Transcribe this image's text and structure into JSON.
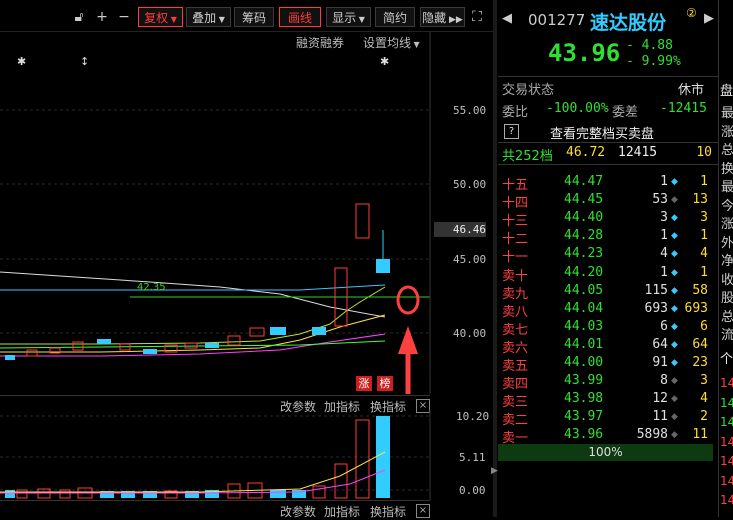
{
  "toolbar": {
    "fq_label": "复权",
    "overlay_label": "叠加",
    "chips_label": "筹码",
    "draw_label": "画线",
    "display_label": "显示",
    "simple_label": "简约",
    "hide_label": "隐藏"
  },
  "chart_header": {
    "margin_label": "融资融券",
    "ma_label": "设置均线"
  },
  "main_chart": {
    "y_ticks": [
      "55.00",
      "50.00",
      "45.00",
      "40.00"
    ],
    "current_price_tag": "46.46",
    "level_label": "42.35",
    "badge_up": "涨",
    "badge_list": "榜"
  },
  "sub_panel_top": {
    "edit_params": "改参数",
    "add_indicator": "加指标",
    "switch_indicator": "换指标"
  },
  "volume_chart": {
    "y_ticks": [
      "10.20",
      "5.11",
      "0.00"
    ]
  },
  "sub_panel_bottom": {
    "edit_params": "改参数",
    "add_indicator": "加指标",
    "switch_indicator": "换指标"
  },
  "stock": {
    "code": "001277",
    "name": "速达股份",
    "badge": "②",
    "price": "43.96",
    "change": "- 4.88",
    "change_pct": "- 9.99%"
  },
  "status": {
    "trade_label": "交易状态",
    "trade_value": "休市",
    "ratio_label": "委比",
    "ratio_value": "-100.00%",
    "diff_label": "委差",
    "diff_value": "-12415",
    "help_icon": "?",
    "full_depth_label": "查看完整档买卖盘"
  },
  "summary": {
    "total_label": "共252档",
    "price": "46.72",
    "volume": "12415",
    "count": "10"
  },
  "order_book": [
    {
      "level": "十五",
      "price": "44.47",
      "vol": "1",
      "count": "1"
    },
    {
      "level": "十四",
      "price": "44.45",
      "vol": "53",
      "count": "13"
    },
    {
      "level": "十三",
      "price": "44.40",
      "vol": "3",
      "count": "3"
    },
    {
      "level": "十二",
      "price": "44.28",
      "vol": "1",
      "count": "1"
    },
    {
      "level": "十一",
      "price": "44.23",
      "vol": "4",
      "count": "4"
    },
    {
      "level": "卖十",
      "price": "44.20",
      "vol": "1",
      "count": "1"
    },
    {
      "level": "卖九",
      "price": "44.05",
      "vol": "115",
      "count": "58"
    },
    {
      "level": "卖八",
      "price": "44.04",
      "vol": "693",
      "count": "693"
    },
    {
      "level": "卖七",
      "price": "44.03",
      "vol": "6",
      "count": "6"
    },
    {
      "level": "卖六",
      "price": "44.01",
      "vol": "64",
      "count": "64"
    },
    {
      "level": "卖五",
      "price": "44.00",
      "vol": "91",
      "count": "23"
    },
    {
      "level": "卖四",
      "price": "43.99",
      "vol": "8",
      "count": "3"
    },
    {
      "level": "卖三",
      "price": "43.98",
      "vol": "12",
      "count": "4"
    },
    {
      "level": "卖二",
      "price": "43.97",
      "vol": "11",
      "count": "2"
    },
    {
      "level": "卖一",
      "price": "43.96",
      "vol": "5898",
      "count": "11"
    }
  ],
  "bid_bar": {
    "pct": "100%"
  },
  "edge": {
    "chars": [
      "最",
      "涨",
      "总",
      "换",
      "最",
      "今",
      "涨",
      "外",
      "净",
      "收",
      "股",
      "总",
      "流"
    ],
    "tab": "盘",
    "tab2": "个",
    "nums": [
      "14",
      "14",
      "14",
      "14",
      "14",
      "14",
      "14"
    ]
  }
}
